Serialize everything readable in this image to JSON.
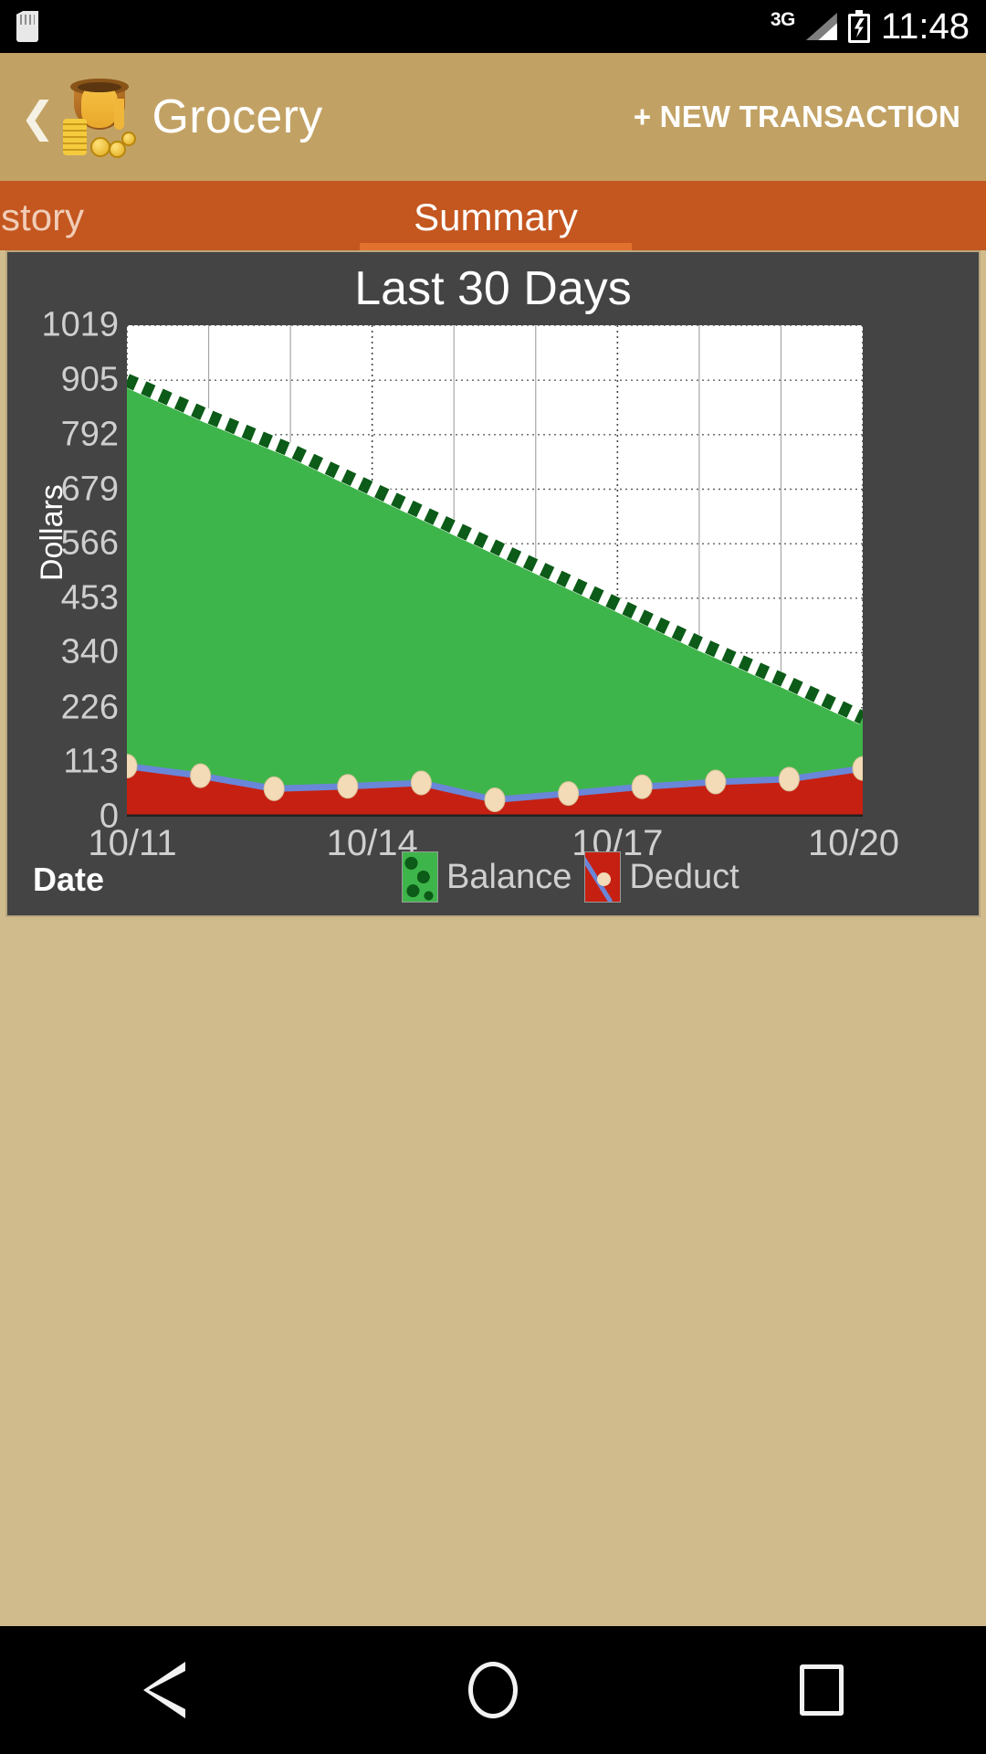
{
  "status_bar": {
    "sd_card_icon": "sd-card-icon",
    "network_type": "3G",
    "signal_icon": "signal-bars-icon",
    "battery_icon": "battery-charging-icon",
    "time": "11:48"
  },
  "app_bar": {
    "back_icon": "back-chevron-icon",
    "app_icon": "money-pot-icon",
    "title": "Grocery",
    "new_transaction_label": "+ NEW TRANSACTION"
  },
  "tabs": [
    {
      "label": "tion History",
      "full_label": "Transaction History",
      "selected": false
    },
    {
      "label": "Summary",
      "selected": true
    }
  ],
  "nav_bar": {
    "back_icon": "nav-back-triangle-icon",
    "home_icon": "nav-home-circle-icon",
    "recents_icon": "nav-recents-square-icon"
  },
  "colors": {
    "status_bar_bg": "#000000",
    "app_bar_bg": "#c2a264",
    "tab_bar_bg": "#c4561f",
    "tab_indicator": "#e2712e",
    "page_bg": "#d0bb8c",
    "chart_card_bg": "#444444",
    "plot_bg": "#ffffff",
    "balance_fill": "#3eb54a",
    "balance_line": "#0c5b18",
    "deduct_fill": "#c62012",
    "deduct_line": "#6a86d8",
    "deduct_point": "#f2dbb6"
  },
  "chart_data": {
    "type": "area",
    "title": "Last 30 Days",
    "xlabel": "Date",
    "ylabel": "Dollars",
    "grid": true,
    "legend_position": "bottom",
    "ylim": [
      0,
      1019
    ],
    "yticks": [
      1019,
      905,
      792,
      679,
      566,
      453,
      340,
      226,
      113,
      0
    ],
    "xticks": [
      "10/11",
      "10/14",
      "10/17",
      "10/20"
    ],
    "x": [
      "10/11",
      "10/12",
      "10/13",
      "10/14",
      "10/15",
      "10/16",
      "10/17",
      "10/18",
      "10/19",
      "10/20"
    ],
    "series": [
      {
        "name": "Balance",
        "color": "#3eb54a",
        "line_color": "#0c5b18",
        "values": [
          905,
          830,
          760,
          680,
          600,
          520,
          440,
          360,
          285,
          205
        ]
      },
      {
        "name": "Deduct",
        "color": "#c62012",
        "line_color": "#6a86d8",
        "point_color": "#f2dbb6",
        "values": [
          105,
          85,
          58,
          63,
          70,
          35,
          48,
          62,
          72,
          78,
          100
        ]
      }
    ]
  }
}
